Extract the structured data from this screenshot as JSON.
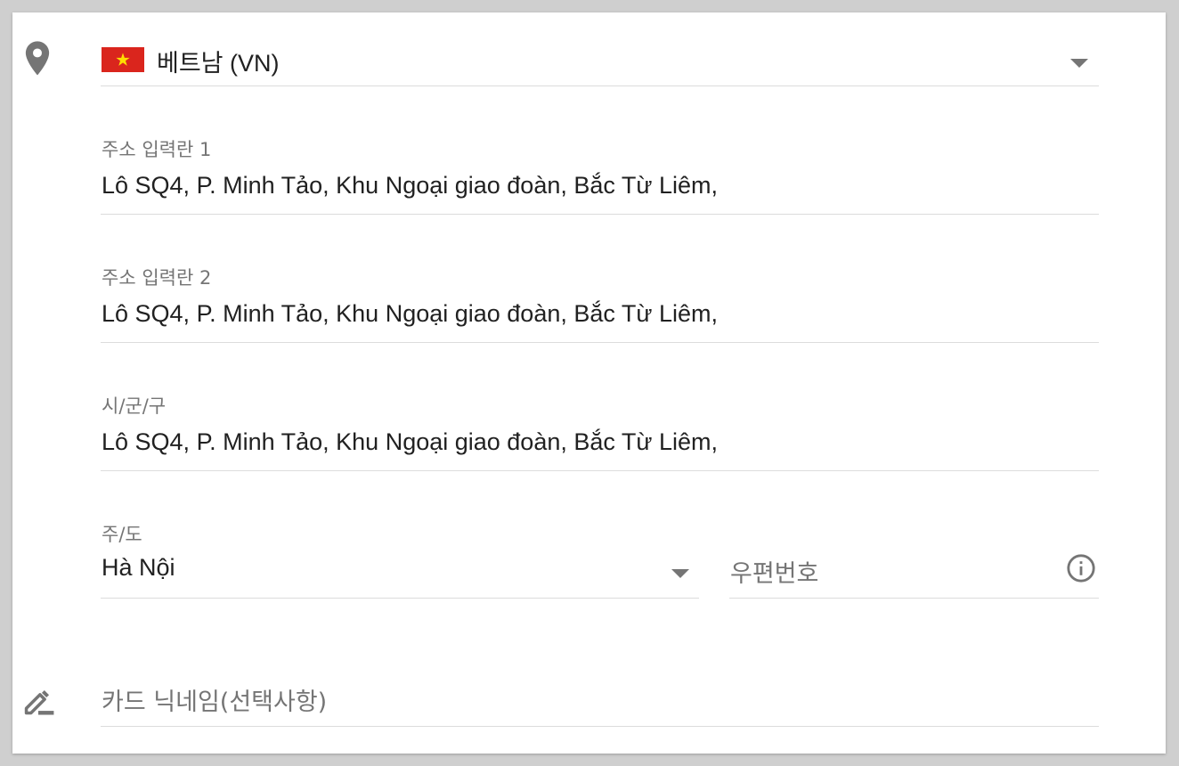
{
  "country": {
    "flag_icon": "vietnam-flag-icon",
    "value": "베트남 (VN)",
    "flag_color": "#da251d",
    "star_color": "#ffdd00"
  },
  "address_line1": {
    "label": "주소 입력란 1",
    "value": "Lô SQ4, P. Minh Tảo, Khu Ngoại giao đoàn, Bắc Từ Liêm,"
  },
  "address_line2": {
    "label": "주소 입력란 2",
    "value": "Lô SQ4, P. Minh Tảo, Khu Ngoại giao đoàn, Bắc Từ Liêm,"
  },
  "city": {
    "label": "시/군/구",
    "value": "Lô SQ4, P. Minh Tảo, Khu Ngoại giao đoàn, Bắc Từ Liêm,"
  },
  "state": {
    "label": "주/도",
    "value": "Hà Nội"
  },
  "postal_code": {
    "placeholder": "우편번호",
    "info_icon": "info-icon"
  },
  "nickname": {
    "placeholder": "카드 닉네임(선택사항)",
    "icon": "pencil-icon"
  },
  "icons": {
    "location": "location-pin-icon",
    "dropdown": "chevron-down-icon"
  },
  "colors": {
    "icon_gray": "#757575",
    "divider": "#dcdcdc",
    "text": "#212121"
  }
}
